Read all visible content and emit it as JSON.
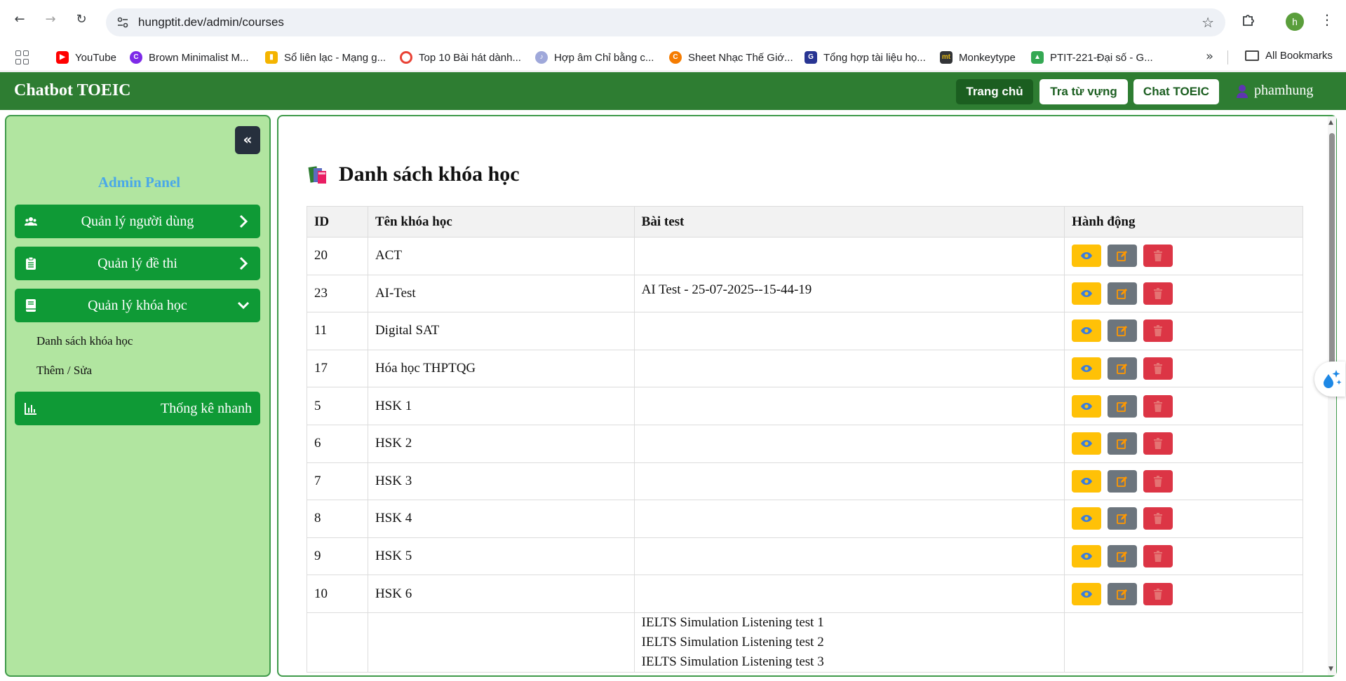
{
  "browser": {
    "url": "hungptit.dev/admin/courses",
    "profile_initial": "h",
    "bookmarks": [
      {
        "label": "YouTube",
        "icon": "youtube-icon",
        "color": "#ff0000"
      },
      {
        "label": "Brown Minimalist M...",
        "icon": "canva-icon",
        "color": "#7d2ae8"
      },
      {
        "label": "Sổ liên lạc - Mạng g...",
        "icon": "chart-icon",
        "color": "#f4b400"
      },
      {
        "label": "Top 10 Bài hát dành...",
        "icon": "circle-icon",
        "color": "#e94235"
      },
      {
        "label": "Hợp âm Chỉ bằng c...",
        "icon": "guitar-icon",
        "color": "#9fa8da"
      },
      {
        "label": "Sheet Nhạc Thế Giớ...",
        "icon": "c-icon",
        "color": "#f57c00"
      },
      {
        "label": "Tổng hợp tài liệu họ...",
        "icon": "g-icon",
        "color": "#283593"
      },
      {
        "label": "Monkeytype",
        "icon": "mt-icon",
        "color": "#e2b714"
      },
      {
        "label": "PTIT-221-Đại số - G...",
        "icon": "drive-icon",
        "color": "#34a853"
      }
    ],
    "all_bookmarks": "All Bookmarks"
  },
  "header": {
    "brand": "Chatbot TOEIC",
    "nav": {
      "home": "Trang chủ",
      "vocab": "Tra từ vựng",
      "chat": "Chat TOEIC"
    },
    "username": "phamhung",
    "color": "#2e7d32"
  },
  "sidebar": {
    "title": "Admin Panel",
    "items": {
      "users": "Quản lý người dùng",
      "exams": "Quản lý đề thi",
      "courses": "Quản lý khóa học",
      "stats": "Thống kê nhanh"
    },
    "sub_items": {
      "list": "Danh sách khóa học",
      "add_edit": "Thêm / Sửa"
    }
  },
  "main": {
    "title": "Danh sách khóa học",
    "columns": [
      "ID",
      "Tên khóa học",
      "Bài test",
      "Hành động"
    ],
    "rows": [
      {
        "id": "20",
        "name": "ACT",
        "test": ""
      },
      {
        "id": "23",
        "name": "AI-Test",
        "test": "AI Test - 25-07-2025--15-44-19"
      },
      {
        "id": "11",
        "name": "Digital SAT",
        "test": ""
      },
      {
        "id": "17",
        "name": "Hóa học THPTQG",
        "test": ""
      },
      {
        "id": "5",
        "name": "HSK 1",
        "test": ""
      },
      {
        "id": "6",
        "name": "HSK 2",
        "test": ""
      },
      {
        "id": "7",
        "name": "HSK 3",
        "test": ""
      },
      {
        "id": "8",
        "name": "HSK 4",
        "test": ""
      },
      {
        "id": "9",
        "name": "HSK 5",
        "test": ""
      },
      {
        "id": "10",
        "name": "HSK 6",
        "test": ""
      }
    ],
    "partial_row_tests": [
      "IELTS Simulation Listening test 1",
      "IELTS Simulation Listening test 2",
      "IELTS Simulation Listening test 3"
    ]
  }
}
